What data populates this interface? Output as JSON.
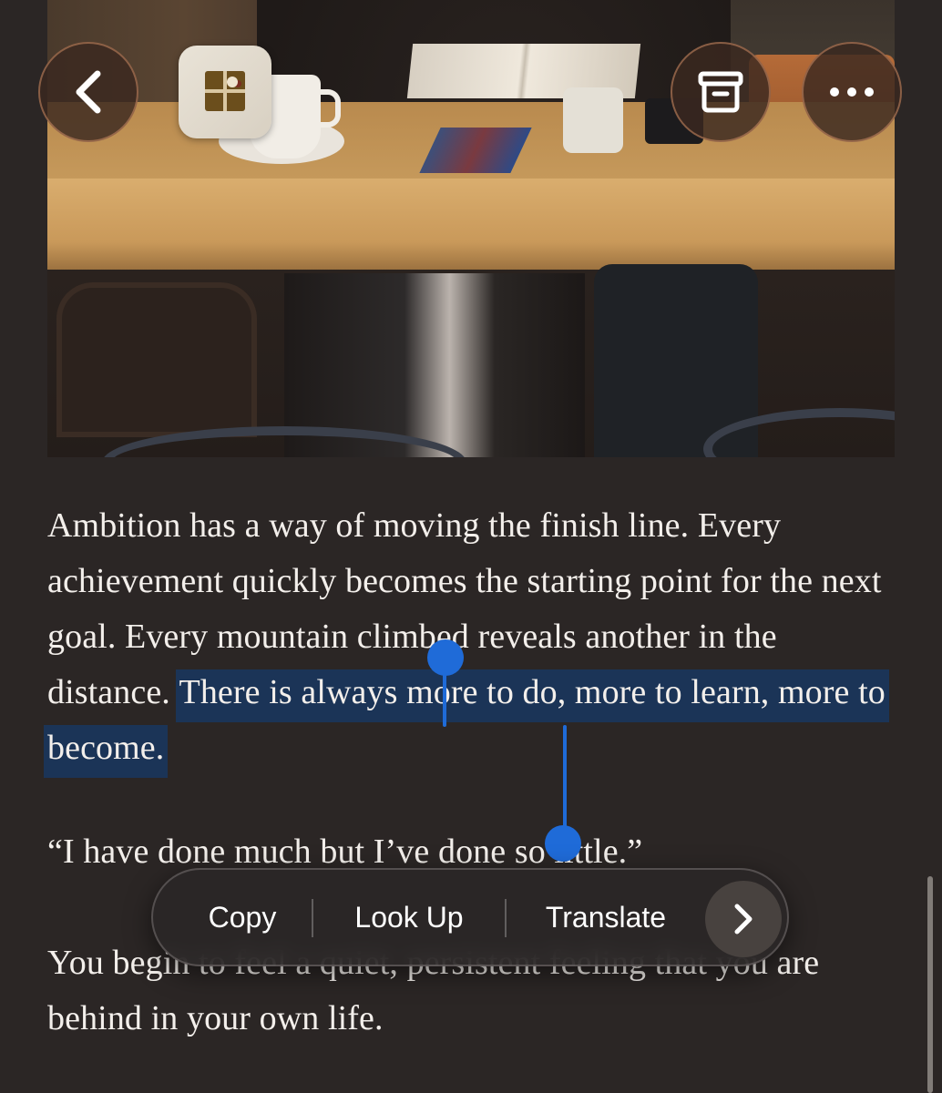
{
  "toolbar": {
    "back_icon": "chevron-left-icon",
    "archive_icon": "archive-box-icon",
    "more_icon": "ellipsis-icon",
    "thumbnail": "gift-box-thumbnail"
  },
  "article": {
    "paragraph1_before": "Ambition has a way of moving the finish line. Every achievement quickly becomes the starting point for the next goal. Every mountain climbed reveals another in the distance. ",
    "paragraph1_selected": "There is always more to do, more to learn, more to become.",
    "paragraph2": "“I have done much but I’ve done so little.”",
    "paragraph3": "You begin to feel a quiet, persistent feeling that you are behind in your own life."
  },
  "context_menu": {
    "copy": "Copy",
    "look_up": "Look Up",
    "translate": "Translate",
    "next_icon": "chevron-right-icon"
  },
  "colors": {
    "background": "#2b2625",
    "selection": "#1b3457",
    "handle": "#1f6bd8"
  }
}
